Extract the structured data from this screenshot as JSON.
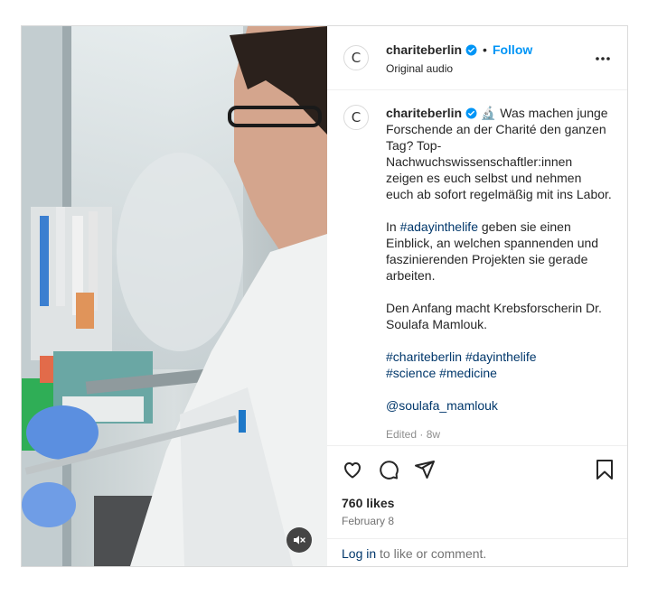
{
  "post": {
    "username": "chariteberlin",
    "follow_label": "Follow",
    "separator": "•",
    "audio_label": "Original audio",
    "avatar_letter": "C"
  },
  "caption": {
    "username": "chariteberlin",
    "emoji": "🔬",
    "para1": "Was machen junge Forschende an der Charité den ganzen Tag? Top-Nachwuchswissenschaftler:innen zeigen es euch selbst und nehmen euch ab sofort regelmäßig mit ins Labor.",
    "para2_prefix": "In ",
    "para2_tag": "#adayinthelife",
    "para2_suffix": " geben sie einen Einblick, an welchen spannenden und faszinierenden Projekten sie gerade arbeiten.",
    "para3": "Den Anfang macht Krebsforscherin Dr. Soulafa Mamlouk.",
    "hashtags": [
      "#chariteberlin",
      "#dayinthelife",
      "#science",
      "#medicine"
    ],
    "mention": "@soulafa_mamlouk",
    "edited": "Edited · 8w"
  },
  "stats": {
    "likes": "760 likes",
    "date": "February 8"
  },
  "footer": {
    "login_label": "Log in",
    "rest": " to like or comment."
  },
  "colors": {
    "accent": "#0095f6",
    "link": "#00376b",
    "verified": "#0095f6"
  },
  "icons": {
    "more": "more-horizontal-icon",
    "like": "heart-icon",
    "comment": "comment-icon",
    "share": "share-icon",
    "save": "bookmark-icon",
    "mute": "speaker-muted-icon"
  }
}
